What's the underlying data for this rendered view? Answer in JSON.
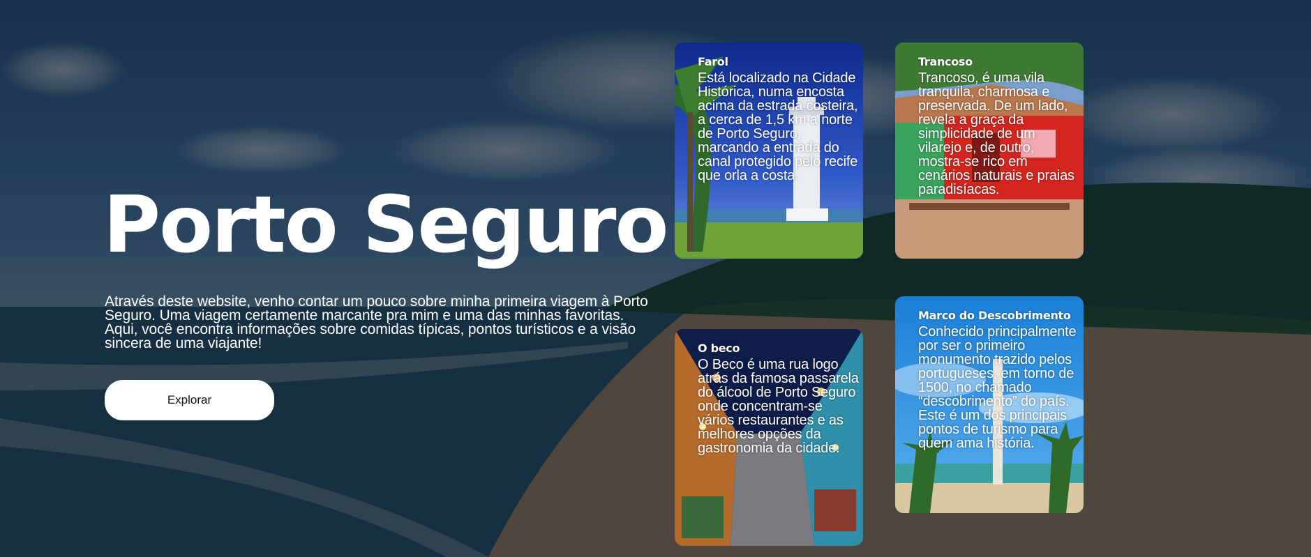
{
  "hero": {
    "title": "Porto Seguro",
    "description": "Através deste website, venho contar um pouco sobre minha primeira viagem à Porto Seguro. Uma viagem certamente marcante pra mim e uma das minhas favoritas. Aqui, você encontra informações sobre comidas típicas, pontos turísticos e a visão sincera de uma viajante!",
    "button_label": "Explorar"
  },
  "cards": [
    {
      "title": "Farol",
      "text": "Está localizado na Cidade Histórica, numa encosta acima da estrada costeira, a cerca de 1,5 km a norte de Porto Seguro, marcando a entrada do canal protegido pelo recife que orla a costa."
    },
    {
      "title": "Trancoso",
      "text": "Trancoso, é uma vila tranquila, charmosa e preservada. De um lado, revela a graça da simplicidade de um vilarejo e, de outro, mostra-se rico em cenários naturais e praias paradisíacas."
    },
    {
      "title": "O beco",
      "text": "O Beco é uma rua logo atrás da famosa passarela do álcool de Porto Seguro onde concentram-se vários restaurantes e as melhores opções da gastronomia da cidade."
    },
    {
      "title": "Marco do Descobrimento",
      "text": "Conhecido principalmente por ser o primeiro monumento trazido pelos portugueses, em torno de 1500, no chamado “descobrimento” do país. Este é um dos principais pontos de turismo para quem ama história."
    }
  ],
  "images": {
    "background": "beach-background-image",
    "farol": "lighthouse-photo",
    "trancoso": "trancoso-village-photo",
    "beco": "beco-street-photo",
    "marco": "marco-monument-photo"
  }
}
